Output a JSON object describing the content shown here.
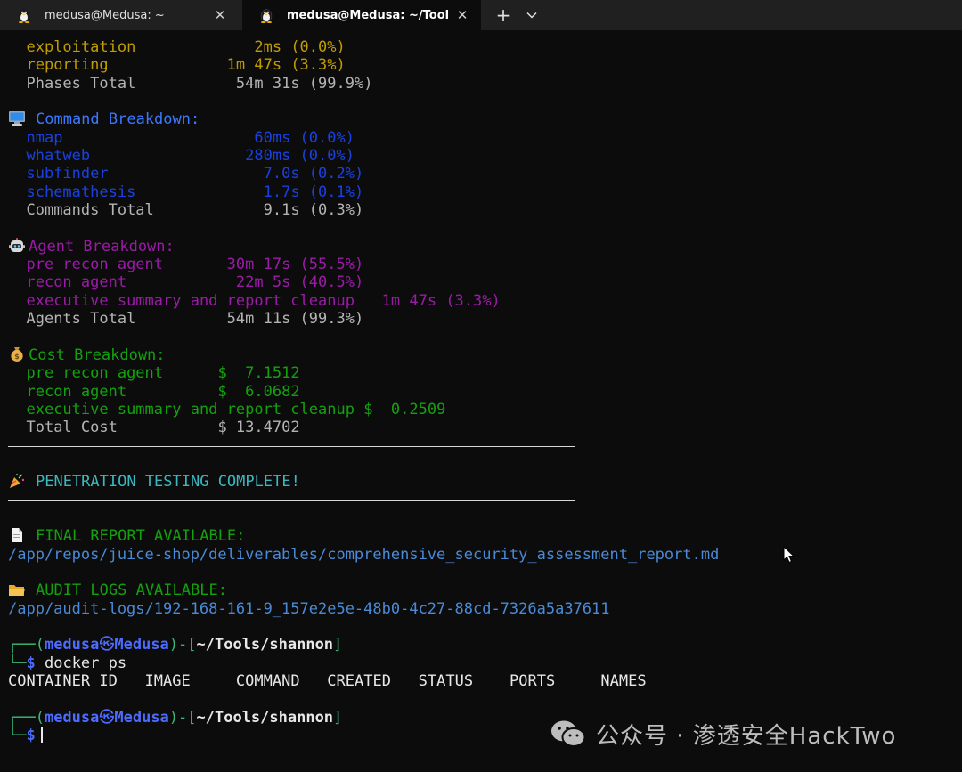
{
  "tabs": [
    {
      "title": "medusa@Medusa: ~",
      "close": "✕",
      "icon": "linux-tux-icon"
    },
    {
      "title": "medusa@Medusa: ~/Tools/sh",
      "close": "✕",
      "icon": "linux-tux-icon"
    }
  ],
  "tab_actions": {
    "new_tab": "+",
    "dropdown": "chevron-down-icon"
  },
  "phases": {
    "rows": [
      {
        "name": "exploitation",
        "value": "2ms (0.0%)"
      },
      {
        "name": "reporting",
        "value": "1m 47s (3.3%)"
      }
    ],
    "total": {
      "name": "Phases Total",
      "value": "54m 31s (99.9%)"
    }
  },
  "commands": {
    "heading": "Command Breakdown:",
    "rows": [
      {
        "name": "nmap",
        "value": "60ms (0.0%)"
      },
      {
        "name": "whatweb",
        "value": "280ms (0.0%)"
      },
      {
        "name": "subfinder",
        "value": "7.0s (0.2%)"
      },
      {
        "name": "schemathesis",
        "value": "1.7s (0.1%)"
      }
    ],
    "total": {
      "name": "Commands Total",
      "value": "9.1s (0.3%)"
    }
  },
  "agents": {
    "heading": "Agent Breakdown:",
    "rows": [
      {
        "name": "pre recon agent",
        "value": "30m 17s (55.5%)"
      },
      {
        "name": "recon agent",
        "value": "22m 5s (40.5%)"
      },
      {
        "name": "executive summary and report cleanup",
        "value": "1m 47s (3.3%)"
      }
    ],
    "total": {
      "name": "Agents Total",
      "value": "54m 11s (99.3%)"
    }
  },
  "costs": {
    "heading": "Cost Breakdown:",
    "rows": [
      {
        "name": "pre recon agent",
        "value": "$  7.1512"
      },
      {
        "name": "recon agent",
        "value": "$  6.0682"
      },
      {
        "name": "executive summary and report cleanup",
        "value": "$  0.2509"
      }
    ],
    "total": {
      "name": "Total Cost",
      "value": "$ 13.4702"
    }
  },
  "complete_banner": "PENETRATION TESTING COMPLETE!",
  "final_report": {
    "heading": "FINAL REPORT AVAILABLE:",
    "path": "/app/repos/juice-shop/deliverables/comprehensive_security_assessment_report.md"
  },
  "audit_logs": {
    "heading": "AUDIT LOGS AVAILABLE:",
    "path": "/app/audit-logs/192-168-161-9_157e2e5e-48b0-4c27-88cd-7326a5a37611"
  },
  "prompt": {
    "user": "medusa",
    "at_symbol": "㉿",
    "host": "Medusa",
    "cwd": "~/Tools/shannon",
    "symbol": "$"
  },
  "command_entered": "docker ps",
  "docker_columns": [
    "CONTAINER ID",
    "IMAGE",
    "COMMAND",
    "CREATED",
    "STATUS",
    "PORTS",
    "NAMES"
  ],
  "watermark": "公众号 · 渗透安全HackTwo",
  "colors": {
    "background": "#0c0c0c",
    "yellow": "#c19c00",
    "blue": "#3b78ff",
    "magenta": "#9c1aa8",
    "green": "#13a10e",
    "cyan": "#3ab8bf",
    "link": "#4a8ad6"
  }
}
